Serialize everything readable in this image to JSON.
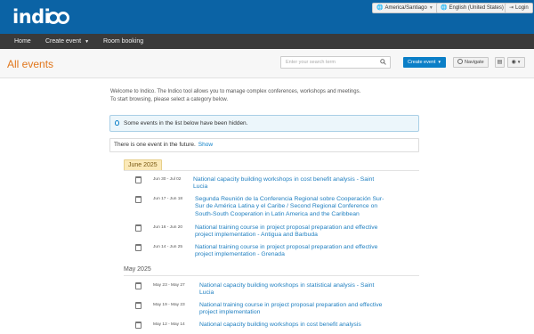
{
  "topbar": {
    "logo_text": "indico",
    "timezone": "America/Santiago",
    "language": "English (United States)",
    "login": "Login"
  },
  "navbar": {
    "items": [
      {
        "label": "Home"
      },
      {
        "label": "Create event",
        "has_dropdown": true
      },
      {
        "label": "Room booking"
      }
    ]
  },
  "titlebar": {
    "title": "All events",
    "search_placeholder": "Enter your search term",
    "create_event": "Create event",
    "navigate": "Navigate"
  },
  "content": {
    "welcome_line1": "Welcome to Indico. The Indico tool allows you to manage complex conferences, workshops and meetings.",
    "welcome_line2": "To start browsing, please select a category below.",
    "hidden_notice": "Some events in the list below have been hidden.",
    "future_notice": "There is one event in the future.",
    "future_show": "Show"
  },
  "months": [
    {
      "label": "June 2025",
      "highlighted": true,
      "events": [
        {
          "dates": "Jun 30 - Jul 02",
          "title_lines": [
            "National capacity building workshops in cost benefit analysis - Saint",
            "Lucia"
          ]
        },
        {
          "dates": "Jun 17 - Jun 18",
          "title_lines": [
            "Segunda Reunión de la Conferencia Regional sobre Cooperación Sur-",
            "Sur de América Latina y el Caribe / Second Regional Conference on",
            "South-South Cooperation in Latin America and the Caribbean"
          ]
        },
        {
          "dates": "Jun 16 - Jun 20",
          "title_lines": [
            "National training course in project proposal preparation and effective",
            "project implementation - Antigua and Barbuda"
          ]
        },
        {
          "dates": "Jun 14 - Jun 25",
          "title_lines": [
            "National training course in project proposal preparation and effective",
            "project implementation - Grenada"
          ]
        }
      ]
    },
    {
      "label": "May 2025",
      "highlighted": false,
      "events": [
        {
          "dates": "May 23 - May 27",
          "title_lines": [
            "National capacity building workshops in statistical analysis - Saint",
            "Lucia"
          ]
        },
        {
          "dates": "May 19 - May 23",
          "title_lines": [
            "National training course in project proposal preparation and effective",
            "project implementation"
          ]
        },
        {
          "dates": "May 12 - May 14",
          "title_lines": [
            "National capacity building workshops in cost benefit analysis"
          ]
        }
      ]
    }
  ],
  "colors": {
    "topbar": "#0b63a5",
    "navbar": "#3a3a3a",
    "title": "#e1771c",
    "link": "#1f7fc0",
    "primary_button": "#0b7fc7"
  }
}
